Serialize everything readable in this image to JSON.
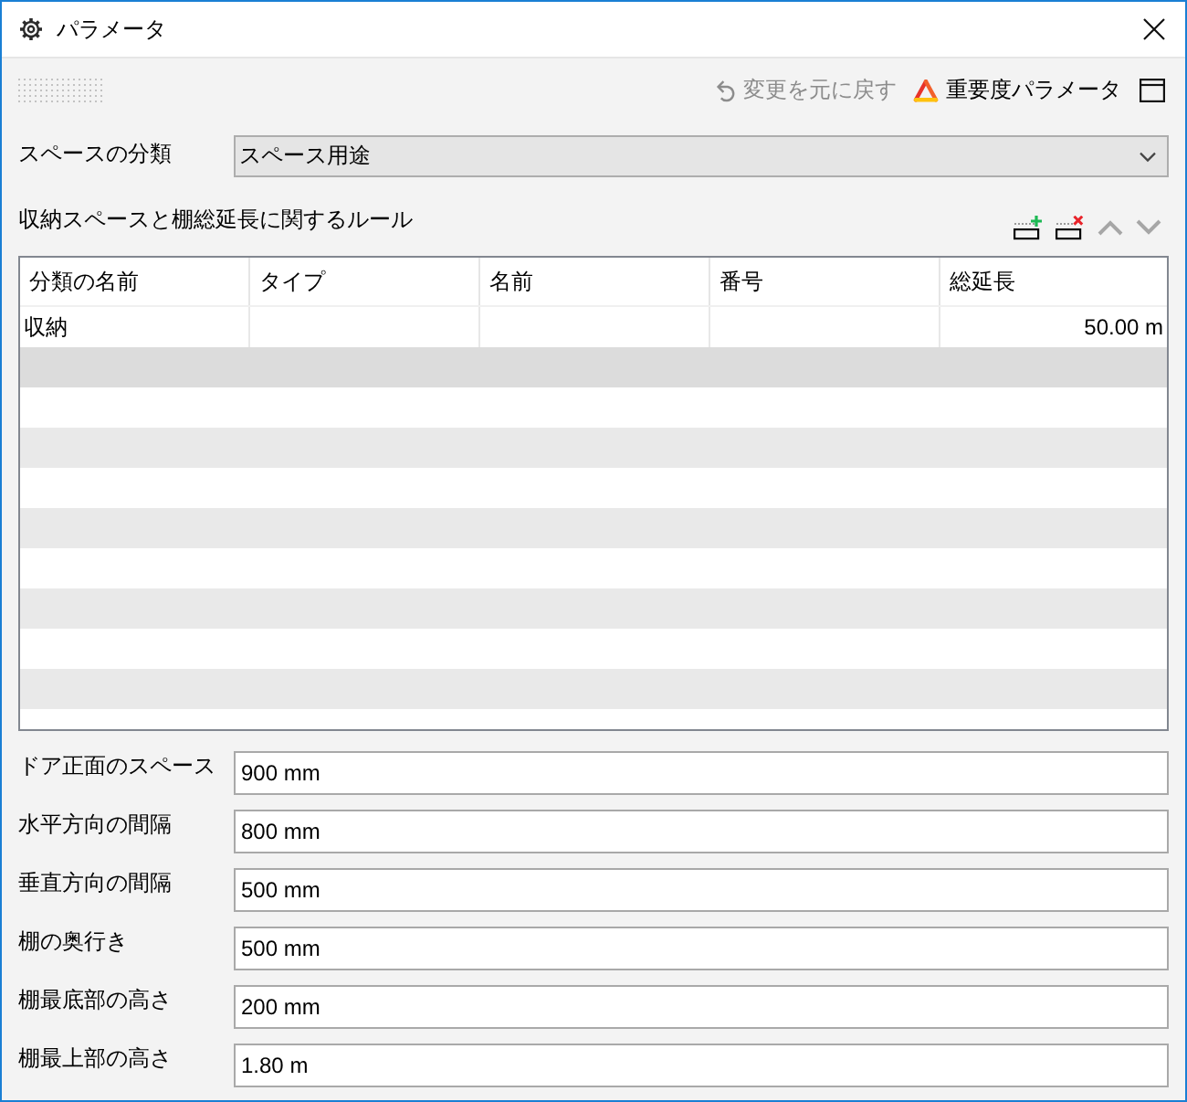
{
  "window": {
    "title": "パラメータ"
  },
  "toolbar": {
    "undo": {
      "label": "変更を元に戻す",
      "disabled": true
    },
    "importance": {
      "label": "重要度パラメータ"
    }
  },
  "classification": {
    "label": "スペースの分類",
    "value": "スペース用途"
  },
  "rules": {
    "title": "収納スペースと棚総延長に関するルール",
    "actions": [
      {
        "kind": "add",
        "disabled": false
      },
      {
        "kind": "delete",
        "disabled": false
      },
      {
        "kind": "move_up",
        "disabled": true
      },
      {
        "kind": "move_down",
        "disabled": true
      }
    ],
    "table": {
      "columns": [
        {
          "label": "分類の名前",
          "kind": "text"
        },
        {
          "label": "タイプ",
          "kind": "text"
        },
        {
          "label": "名前",
          "kind": "text"
        },
        {
          "label": "番号",
          "kind": "text"
        },
        {
          "label": "総延長",
          "kind": "measure"
        }
      ],
      "rows": [
        {
          "cells": [
            "収納",
            null,
            null,
            null,
            "50.00 m"
          ]
        }
      ]
    }
  },
  "fields": [
    {
      "label": "ドア正面のスペース",
      "value": "900 mm"
    },
    {
      "label": "水平方向の間隔",
      "value": "800 mm"
    },
    {
      "label": "垂直方向の間隔",
      "value": "500 mm"
    },
    {
      "label": "棚の奥行き",
      "value": "500 mm"
    },
    {
      "label": "棚最底部の高さ",
      "value": "200 mm"
    },
    {
      "label": "棚最上部の高さ",
      "value": "1.80 m"
    }
  ]
}
